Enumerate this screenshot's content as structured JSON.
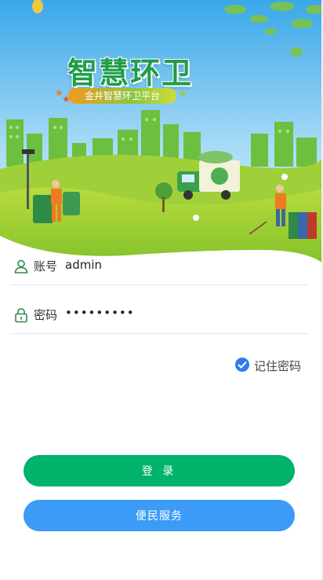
{
  "brand": {
    "title": "智慧环卫",
    "subtitle": "金井智慧环卫平台"
  },
  "form": {
    "account": {
      "label": "账号",
      "value": "admin",
      "icon": "user-icon"
    },
    "password": {
      "label": "密码",
      "masked_value": "•••••••••",
      "icon": "lock-icon"
    },
    "remember": {
      "label": "记住密码",
      "checked": true
    }
  },
  "buttons": {
    "login": "登 录",
    "service": "便民服务"
  },
  "colors": {
    "login_button": "#00b26a",
    "service_button": "#3b9bf6",
    "checkbox": "#2f7ce8",
    "sky_top": "#4fb3f0",
    "grass": "#8cc63f"
  }
}
